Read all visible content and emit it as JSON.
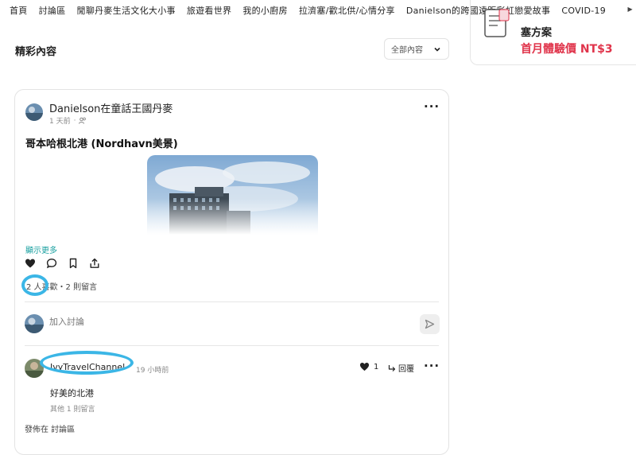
{
  "nav": {
    "items": [
      "首頁",
      "討論區",
      "閒聊丹麥生活文化大小事",
      "旅遊看世界",
      "我的小廚房",
      "拉濟塞/歡北供/心情分享",
      "Danielson的跨國遠距彩虹戀愛故事",
      "COVID-19"
    ]
  },
  "section": {
    "title": "精彩內容"
  },
  "filter": {
    "value": "全部內容",
    "icon": "chevron-down-icon"
  },
  "promo": {
    "line1": "塞方案",
    "line2": "首月體驗價 NT$3",
    "icon": "document-icon"
  },
  "post": {
    "author": "Danielson在童話王國丹麥",
    "time": "1 天前",
    "audience_icon": "friends-icon",
    "title": "哥本哈根北港 (Nordhavn美景)",
    "show_more": "顯示更多",
    "likes_text": "2 人喜歡・2 則留言",
    "actions": [
      "heart-icon",
      "comment-icon",
      "bookmark-icon",
      "share-icon"
    ]
  },
  "comment_box": {
    "placeholder": "加入討論"
  },
  "comment": {
    "author": "IvyTravelChannel",
    "time": "19 小時前",
    "like_count": "1",
    "reply_label": "回覆",
    "text": "好美的北港",
    "other": "其他 1 則留言"
  },
  "footer": {
    "posted_in": "發佈在 討論區"
  },
  "colors": {
    "accent_teal": "#1aa0a0",
    "promo_red": "#e0344b",
    "highlight": "#3bb6e6"
  }
}
